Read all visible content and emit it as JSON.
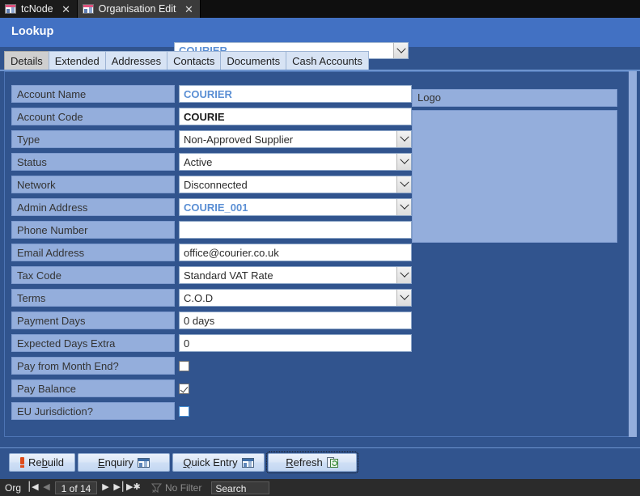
{
  "window": {
    "tabs": [
      {
        "label": "tcNode",
        "icon": "form-icon",
        "active": false,
        "close": "✕"
      },
      {
        "label": "Organisation Edit",
        "icon": "form-icon",
        "active": true,
        "close": "✕"
      }
    ]
  },
  "header": {
    "title": "Lookup",
    "lookup_value": "COURIER",
    "accent_color": "#4271c3"
  },
  "form_tabs": [
    {
      "label": "Details",
      "selected": true
    },
    {
      "label": "Extended",
      "selected": false
    },
    {
      "label": "Addresses",
      "selected": false
    },
    {
      "label": "Contacts",
      "selected": false
    },
    {
      "label": "Documents",
      "selected": false
    },
    {
      "label": "Cash Accounts",
      "selected": false
    }
  ],
  "fields": [
    {
      "label": "Account Name",
      "value": "COURIER",
      "type": "text",
      "style": "link"
    },
    {
      "label": "Account Code",
      "value": "COURIE",
      "type": "text",
      "style": "strong"
    },
    {
      "label": "Type",
      "value": "Non-Approved Supplier",
      "type": "combo",
      "style": ""
    },
    {
      "label": "Status",
      "value": "Active",
      "type": "combo",
      "style": ""
    },
    {
      "label": "Network",
      "value": "Disconnected",
      "type": "combo",
      "style": ""
    },
    {
      "label": "Admin Address",
      "value": "COURIE_001",
      "type": "combo",
      "style": "link"
    },
    {
      "label": "Phone Number",
      "value": "",
      "type": "text",
      "style": ""
    },
    {
      "label": "Email Address",
      "value": "office@courier.co.uk",
      "type": "text",
      "style": ""
    },
    {
      "label": "Tax Code",
      "value": "Standard VAT Rate",
      "type": "combo",
      "style": ""
    },
    {
      "label": "Terms",
      "value": "C.O.D",
      "type": "combo",
      "style": ""
    },
    {
      "label": "Payment Days",
      "value": "0 days",
      "type": "text",
      "style": ""
    },
    {
      "label": "Expected Days Extra",
      "value": "0",
      "type": "text",
      "style": ""
    },
    {
      "label": "Pay from Month End?",
      "value": "",
      "type": "checkbox",
      "checked": false,
      "flat": false
    },
    {
      "label": "Pay Balance",
      "value": "",
      "type": "checkbox",
      "checked": true,
      "flat": false
    },
    {
      "label": "EU Jurisdiction?",
      "value": "",
      "type": "checkbox",
      "checked": false,
      "flat": true
    }
  ],
  "logo_panel": {
    "header": "Logo",
    "image": ""
  },
  "buttons": [
    {
      "id": "rebuild",
      "pre": "Re",
      "accel": "b",
      "post": "uild",
      "icon": "exclamation-icon",
      "focused": false
    },
    {
      "id": "enquiry",
      "pre": "",
      "accel": "E",
      "post": "nquiry",
      "icon": "datasheet-icon",
      "focused": false
    },
    {
      "id": "quick-entry",
      "pre": "",
      "accel": "Q",
      "post": "uick Entry",
      "icon": "datasheet-icon",
      "focused": false
    },
    {
      "id": "refresh",
      "pre": "",
      "accel": "R",
      "post": "efresh",
      "icon": "refresh-icon",
      "focused": true
    }
  ],
  "status": {
    "record_type": "Org",
    "first_glyph": "⎮◀",
    "prev_glyph": "◀",
    "record_text": "1 of 14",
    "next_glyph": "▶",
    "last_glyph": "▶⎮",
    "new_glyph": "▶✱",
    "filter_label": "No Filter",
    "search_label": "Search"
  }
}
